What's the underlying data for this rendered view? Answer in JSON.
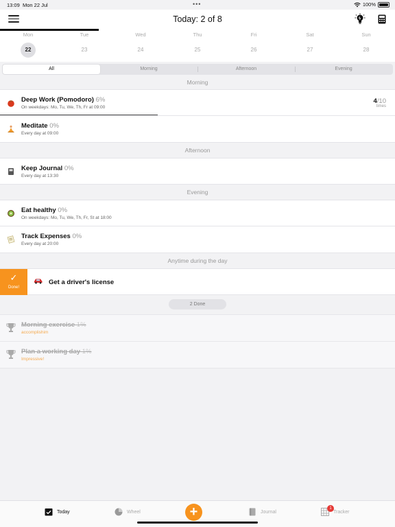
{
  "status_bar": {
    "time": "13:09",
    "date": "Mon 22 Jul",
    "battery": "100%"
  },
  "header": {
    "title": "Today: 2 of 8"
  },
  "week": [
    {
      "name": "Mon",
      "num": "22",
      "active": true
    },
    {
      "name": "Tue",
      "num": "23"
    },
    {
      "name": "Wed",
      "num": "24"
    },
    {
      "name": "Thu",
      "num": "25"
    },
    {
      "name": "Fri",
      "num": "26"
    },
    {
      "name": "Sat",
      "num": "27"
    },
    {
      "name": "Sun",
      "num": "28"
    }
  ],
  "filters": [
    "All",
    "Morning",
    "Afternoon",
    "Evening"
  ],
  "sections": {
    "morning": "Morning",
    "afternoon": "Afternoon",
    "evening": "Evening",
    "anytime": "Anytime during the day"
  },
  "habits": {
    "deep_work": {
      "title": "Deep Work (Pomodoro)",
      "pct": "6%",
      "sub": "On weekdays: Mo, Tu, We, Th, Fr at 09:00",
      "count": "4",
      "total": "/10",
      "unit": "times",
      "icon": "tomato-icon",
      "progress": 0.4
    },
    "meditate": {
      "title": "Meditate",
      "pct": "0%",
      "sub": "Every day at 09:00",
      "icon": "meditation-icon"
    },
    "journal": {
      "title": "Keep Journal",
      "pct": "0%",
      "sub": "Every day at 13:30",
      "icon": "notebook-icon"
    },
    "eat": {
      "title": "Eat healthy",
      "pct": "0%",
      "sub": "On weekdays: Mo, Tu, We, Th, Fr, St at 18:00",
      "icon": "kiwi-icon"
    },
    "expenses": {
      "title": "Track Expenses",
      "pct": "0%",
      "sub": "Every day at 20:00",
      "icon": "receipt-icon"
    },
    "license": {
      "title": "Get a driver's license",
      "done_label": "Done!",
      "icon": "car-icon"
    }
  },
  "done_section": {
    "label": "2 Done",
    "items": [
      {
        "title": "Morning exercise",
        "pct": "1%",
        "sub": "accomplishim"
      },
      {
        "title": "Plan a working day",
        "pct": "1%",
        "sub": "Impressive!"
      }
    ]
  },
  "tabs": {
    "today": "Today",
    "wheel": "Wheel",
    "journal": "Journal",
    "tracker": "Tracker",
    "tracker_badge": "1"
  },
  "colors": {
    "accent": "#f7931e",
    "badge": "#e53935"
  }
}
